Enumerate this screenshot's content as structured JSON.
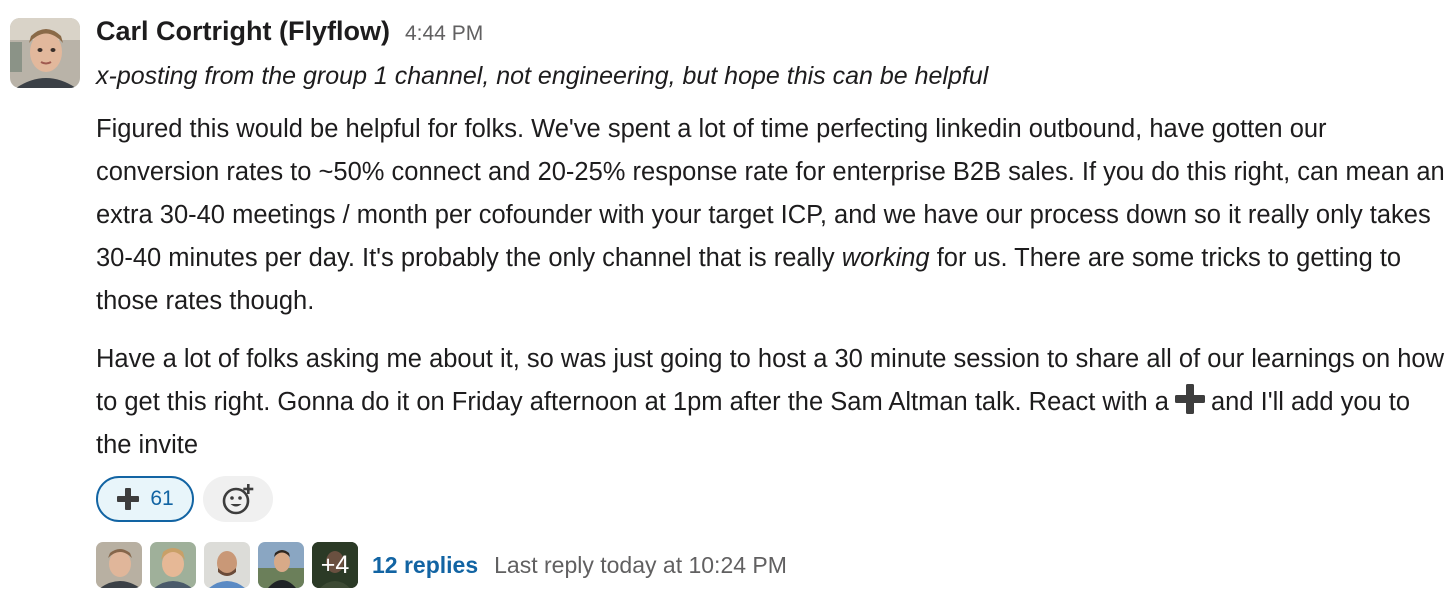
{
  "message": {
    "sender": "Carl Cortright (Flyflow)",
    "timestamp": "4:44 PM",
    "forward_note": "x-posting from the group 1 channel, not engineering, but hope this can be helpful",
    "paragraph1": "Figured this would be helpful for folks. We've spent a lot of time perfecting linkedin outbound, have gotten our conversion rates to ~50% connect and 20-25% response rate for enterprise B2B sales. If you do this right, can mean an extra 30-40 meetings / month per cofounder with your target ICP, and we have our process down so it really only takes 30-40 minutes per day. It's probably the only channel that is really ",
    "paragraph1_emphasis": "working",
    "paragraph1_end": " for us. There are some tricks to getting to those rates though.",
    "paragraph2": "Have a lot of folks asking me about it, so was just going to host a 30 minute session to share all of our learnings on how to get this right. Gonna do it on Friday afternoon at 1pm after the Sam Altman talk. React with a",
    "paragraph2_end": "and I'll add you to the invite",
    "inline_emoji": "heavy-plus-icon"
  },
  "reactions": [
    {
      "emoji": "heavy-plus-icon",
      "count": "61"
    }
  ],
  "add_reaction_icon": "add-emoji-icon",
  "thread": {
    "extra_participants": "+4",
    "replies": "12 replies",
    "last_reply": "Last reply today at 10:24 PM"
  },
  "colors": {
    "link": "#1264a3",
    "muted": "#616061",
    "reaction_bg": "#e8f5fa",
    "text": "#1d1c1d"
  }
}
